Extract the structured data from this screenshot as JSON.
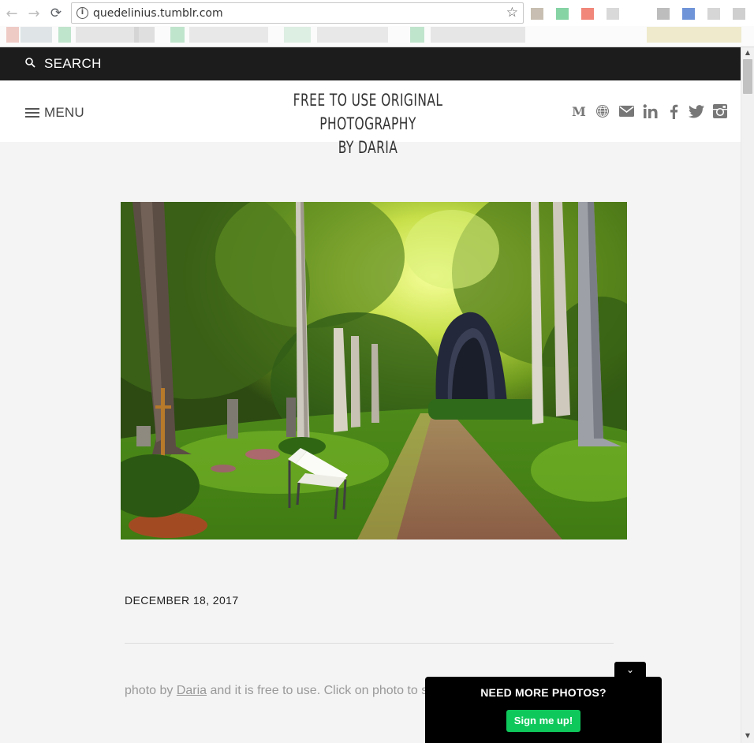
{
  "browser": {
    "url": "quedelinius.tumblr.com",
    "back_glyph": "←",
    "forward_glyph": "→",
    "reload_glyph": "⟳",
    "info_glyph": "i",
    "star_glyph": "☆",
    "extension_colors": [
      "#c8bfb2",
      "#86d3a4",
      "#f0877a",
      "#d9d9d9",
      "#bdbdbd",
      "#6f94d8",
      "#d6d6d6",
      "#cfcfcf"
    ],
    "bookmark_colors": [
      "#e5a49a",
      "#c9d3d7",
      "#8fd4a8",
      "#d3d3d3",
      "#c9c9c9",
      "#8fd4a8",
      "#d9d9d9",
      "#c4e3d0",
      "#d9d9d9",
      "#8fd4a8",
      "#d6d6d6",
      "#e5dca5"
    ]
  },
  "page": {
    "search": {
      "label": "SEARCH",
      "icon": "search-icon"
    },
    "menu": {
      "label": "MENU",
      "icon": "hamburger-icon"
    },
    "site_title": [
      "FREE TO USE ORIGINAL PHOTOGRAPHY",
      "BY DARIA"
    ],
    "social_icons": [
      "medium-icon",
      "globe-icon",
      "mail-icon",
      "linkedin-icon",
      "facebook-icon",
      "twitter-icon",
      "instagram-icon"
    ],
    "social_color": "#777777",
    "post": {
      "photo_alt": "Forest cemetery path with white bench and dark arch sculpture",
      "date": "DECEMBER 18, 2017",
      "caption_prefix": "photo by ",
      "caption_link": "Daria",
      "caption_suffix": " and it is free to use. Click on photo to s"
    },
    "popup": {
      "toggle_glyph": "⌄",
      "title": "NEED MORE PHOTOS?",
      "button": "Sign me up!",
      "button_color": "#0fc85c"
    }
  },
  "scrollbar": {
    "up_glyph": "▲",
    "down_glyph": "▼"
  }
}
